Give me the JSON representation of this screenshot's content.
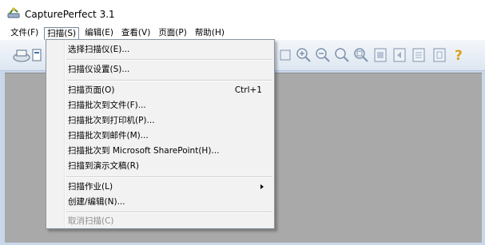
{
  "app": {
    "title": "CapturePerfect 3.1",
    "icon": "scanner-app-icon"
  },
  "menubar": {
    "items": [
      {
        "label": "文件(F)"
      },
      {
        "label": "扫描(S)",
        "open": true
      },
      {
        "label": "编辑(E)"
      },
      {
        "label": "查看(V)"
      },
      {
        "label": "页面(P)"
      },
      {
        "label": "帮助(H)"
      }
    ]
  },
  "toolbar": {
    "icons": [
      "scanner-icon",
      "copy-icon",
      "zoom-in-icon",
      "zoom-out-icon",
      "zoom-100-icon",
      "zoom-fit-icon",
      "first-page-icon",
      "prev-page-icon",
      "next-page-icon",
      "last-page-icon",
      "help-icon"
    ]
  },
  "scan_menu": {
    "items": [
      {
        "label": "选择扫描仪(E)...",
        "enabled": true
      },
      {
        "label": "扫描仪设置(S)...",
        "enabled": true
      },
      {
        "label": "扫描页面(O)",
        "shortcut": "Ctrl+1",
        "enabled": true
      },
      {
        "label": "扫描批次到文件(F)...",
        "enabled": true
      },
      {
        "label": "扫描批次到打印机(P)...",
        "enabled": true
      },
      {
        "label": "扫描批次到邮件(M)...",
        "enabled": true
      },
      {
        "label": "扫描批次到 Microsoft SharePoint(H)...",
        "enabled": true
      },
      {
        "label": "扫描到演示文稿(R)",
        "enabled": true
      },
      {
        "label": "扫描作业(L)",
        "submenu": true,
        "enabled": true
      },
      {
        "label": "创建/编辑(N)...",
        "enabled": true
      },
      {
        "label": "取消扫描(C)",
        "enabled": false
      }
    ]
  },
  "colors": {
    "workspace": "#a9a9a9",
    "menu_bg": "#f2f2f2",
    "disabled_text": "#8d8d8d"
  }
}
